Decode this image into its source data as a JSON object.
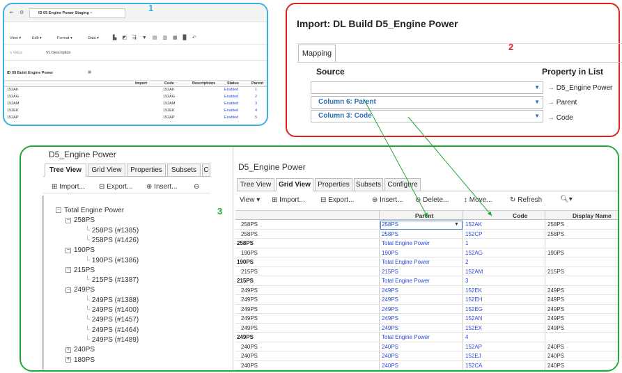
{
  "labels": {
    "n1": "1",
    "n2": "2",
    "n3": "3"
  },
  "panel1": {
    "tab_title": "ID 05 Engine Power Staging",
    "toolbar": [
      "View ▾",
      "Edit ▾",
      "Format ▾",
      "Data ▾"
    ],
    "filter_label": "VL Description",
    "sheet_title": "ID 05 Build Engine Power",
    "columns": [
      "Import",
      "Code",
      "Descriptions",
      "Status",
      "Parent"
    ],
    "rows": [
      [
        "152AK",
        "152AK",
        "Enabled",
        "1"
      ],
      [
        "152AG",
        "152AG",
        "Enabled",
        "2"
      ],
      [
        "152AM",
        "152AM",
        "Enabled",
        "3"
      ],
      [
        "152EK",
        "152EK",
        "Enabled",
        "4"
      ],
      [
        "152AP",
        "152AP",
        "Enabled",
        "5"
      ]
    ]
  },
  "panel2": {
    "title": "Import: DL Build D5_Engine Power",
    "tab": "Mapping",
    "source_header": "Source",
    "property_header": "Property in List",
    "rows": [
      {
        "source": "",
        "property": "D5_Engine Power"
      },
      {
        "source": "Column 6: Parent",
        "property": "Parent"
      },
      {
        "source": "Column 3: Code",
        "property": "Code"
      }
    ]
  },
  "panel3": {
    "left_title": "D5_Engine Power",
    "left_tabs": [
      "Tree View",
      "Grid View",
      "Properties",
      "Subsets",
      "C"
    ],
    "left_toolbar": [
      "Import...",
      "Export...",
      "Insert..."
    ],
    "tree": [
      {
        "label": "Total Engine Power",
        "level": 0,
        "exp": "−"
      },
      {
        "label": "258PS",
        "level": 1,
        "exp": "−"
      },
      {
        "label": "258PS (#1385)",
        "level": 2,
        "exp": ""
      },
      {
        "label": "258PS (#1426)",
        "level": 2,
        "exp": ""
      },
      {
        "label": "190PS",
        "level": 1,
        "exp": "−"
      },
      {
        "label": "190PS (#1386)",
        "level": 2,
        "exp": ""
      },
      {
        "label": "215PS",
        "level": 1,
        "exp": "−"
      },
      {
        "label": "215PS (#1387)",
        "level": 2,
        "exp": ""
      },
      {
        "label": "249PS",
        "level": 1,
        "exp": "−"
      },
      {
        "label": "249PS (#1388)",
        "level": 2,
        "exp": ""
      },
      {
        "label": "249PS (#1400)",
        "level": 2,
        "exp": ""
      },
      {
        "label": "249PS (#1457)",
        "level": 2,
        "exp": ""
      },
      {
        "label": "249PS (#1464)",
        "level": 2,
        "exp": ""
      },
      {
        "label": "249PS (#1489)",
        "level": 2,
        "exp": ""
      },
      {
        "label": "240PS",
        "level": 1,
        "exp": "+"
      },
      {
        "label": "180PS",
        "level": 1,
        "exp": "+"
      }
    ],
    "right_title": "D5_Engine Power",
    "right_tabs": [
      "Tree View",
      "Grid View",
      "Properties",
      "Subsets",
      "Configure"
    ],
    "right_toolbar": [
      "View ▾",
      "Import...",
      "Export...",
      "Insert...",
      "Delete...",
      "Move...",
      "Refresh"
    ],
    "grid_columns": [
      "Parent",
      "Code",
      "Display Name"
    ],
    "grid_rows": [
      [
        "258PS",
        "258PS",
        "152AK",
        "258PS",
        false
      ],
      [
        "258PS",
        "258PS",
        "152CP",
        "258PS",
        false
      ],
      [
        "258PS",
        "Total Engine Power",
        "1",
        "",
        true
      ],
      [
        "190PS",
        "190PS",
        "152AG",
        "190PS",
        false
      ],
      [
        "190PS",
        "Total Engine Power",
        "2",
        "",
        true
      ],
      [
        "215PS",
        "215PS",
        "152AM",
        "215PS",
        false
      ],
      [
        "215PS",
        "Total Engine Power",
        "3",
        "",
        true
      ],
      [
        "249PS",
        "249PS",
        "152EK",
        "249PS",
        false
      ],
      [
        "249PS",
        "249PS",
        "152EH",
        "249PS",
        false
      ],
      [
        "249PS",
        "249PS",
        "152EG",
        "249PS",
        false
      ],
      [
        "249PS",
        "249PS",
        "152AN",
        "249PS",
        false
      ],
      [
        "249PS",
        "249PS",
        "152EX",
        "249PS",
        false
      ],
      [
        "249PS",
        "Total Engine Power",
        "4",
        "",
        true
      ],
      [
        "240PS",
        "240PS",
        "152AP",
        "240PS",
        false
      ],
      [
        "240PS",
        "240PS",
        "152EJ",
        "240PS",
        false
      ],
      [
        "240PS",
        "240PS",
        "152CA",
        "240PS",
        false
      ]
    ]
  },
  "colors": {
    "p1": "#3ab0e0",
    "p2": "#e02020",
    "p3": "#22a838",
    "link": "#2b4bd6"
  }
}
